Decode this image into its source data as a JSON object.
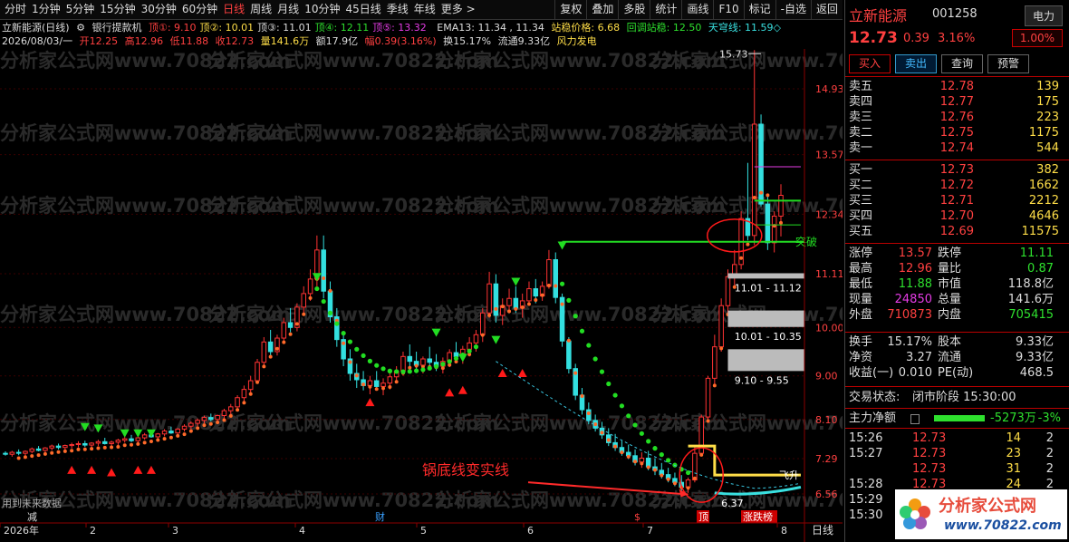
{
  "toolbar": {
    "periods": [
      "分时",
      "1分钟",
      "5分钟",
      "15分钟",
      "30分钟",
      "60分钟",
      "日线",
      "周线",
      "月线",
      "10分钟",
      "45日线",
      "季线",
      "年线",
      "更多 >"
    ],
    "active_period": "日线",
    "actions": [
      "复权",
      "叠加",
      "多股",
      "统计",
      "画线",
      "F10",
      "标记",
      "-自选",
      "返回"
    ]
  },
  "header": {
    "stock_name": "立新能源(日线)",
    "indicator_name": "银行提款机",
    "dings": [
      {
        "label": "顶①:",
        "value": "9.10",
        "color": "#ff4040"
      },
      {
        "label": "顶②:",
        "value": "10.01",
        "color": "#ffde48"
      },
      {
        "label": "顶③:",
        "value": "11.01",
        "color": "#ddd"
      },
      {
        "label": "顶④:",
        "value": "12.11",
        "color": "#2ee02e"
      },
      {
        "label": "顶⑤:",
        "value": "13.32",
        "color": "#e53ce5"
      }
    ],
    "ema": "EMA13: 11.34 , 11.34",
    "zhanwen": "站稳价格: 6.68",
    "huitiao": "回调站稳: 12.50",
    "tianqiong": "天穹线: 11.59◇",
    "line2": {
      "date": "2026/08/03/一",
      "open": "开12.25",
      "high": "高12.96",
      "low": "低11.88",
      "close": "收12.73",
      "vol": "量141.6万",
      "amt": "额17.9亿",
      "amp": "幅0.39(3.16%)",
      "turn": "换15.17%",
      "float": "流通9.33亿",
      "concept": "风力发电"
    }
  },
  "chart_data": {
    "type": "candlestick",
    "y_ticks": [
      "14.93",
      "13.57",
      "12.34",
      "11.11",
      "10.00",
      "9.00",
      "8.10",
      "7.29",
      "6.56"
    ],
    "x_ticks": [
      "2026年",
      "2",
      "3",
      "4",
      "5",
      "6",
      "7",
      "8"
    ],
    "candles": [
      [
        7.4,
        7.44,
        7.35,
        7.38
      ],
      [
        7.38,
        7.45,
        7.33,
        7.42
      ],
      [
        7.42,
        7.48,
        7.36,
        7.4
      ],
      [
        7.4,
        7.46,
        7.34,
        7.44
      ],
      [
        7.44,
        7.52,
        7.4,
        7.49
      ],
      [
        7.49,
        7.55,
        7.44,
        7.46
      ],
      [
        7.46,
        7.53,
        7.42,
        7.51
      ],
      [
        7.51,
        7.58,
        7.46,
        7.55
      ],
      [
        7.55,
        7.6,
        7.48,
        7.52
      ],
      [
        7.52,
        7.58,
        7.45,
        7.56
      ],
      [
        7.56,
        7.62,
        7.5,
        7.58
      ],
      [
        7.58,
        7.65,
        7.52,
        7.6
      ],
      [
        7.6,
        7.66,
        7.53,
        7.57
      ],
      [
        7.57,
        7.63,
        7.5,
        7.61
      ],
      [
        7.61,
        7.68,
        7.55,
        7.64
      ],
      [
        7.64,
        7.72,
        7.58,
        7.6
      ],
      [
        7.6,
        7.66,
        7.52,
        7.63
      ],
      [
        7.63,
        7.7,
        7.57,
        7.67
      ],
      [
        7.67,
        7.75,
        7.62,
        7.7
      ],
      [
        7.7,
        7.78,
        7.63,
        7.66
      ],
      [
        7.66,
        7.74,
        7.6,
        7.72
      ],
      [
        7.72,
        7.82,
        7.68,
        7.78
      ],
      [
        7.78,
        7.86,
        7.72,
        7.74
      ],
      [
        7.74,
        7.82,
        7.68,
        7.8
      ],
      [
        7.8,
        7.9,
        7.75,
        7.86
      ],
      [
        7.86,
        7.95,
        7.8,
        7.82
      ],
      [
        7.82,
        7.92,
        7.77,
        7.9
      ],
      [
        7.9,
        8.0,
        7.85,
        7.96
      ],
      [
        7.96,
        8.06,
        7.9,
        8.02
      ],
      [
        8.02,
        8.12,
        7.96,
        8.08
      ],
      [
        8.08,
        8.18,
        8.02,
        8.14
      ],
      [
        8.14,
        8.22,
        8.06,
        8.1
      ],
      [
        8.1,
        8.2,
        8.04,
        8.18
      ],
      [
        8.18,
        8.32,
        8.12,
        8.28
      ],
      [
        8.28,
        8.42,
        8.2,
        8.36
      ],
      [
        8.36,
        8.6,
        8.3,
        8.55
      ],
      [
        8.55,
        8.8,
        8.48,
        8.72
      ],
      [
        8.72,
        9.0,
        8.65,
        8.9
      ],
      [
        8.9,
        9.35,
        8.84,
        9.28
      ],
      [
        9.28,
        9.8,
        9.2,
        9.7
      ],
      [
        9.7,
        9.95,
        9.4,
        9.5
      ],
      [
        9.5,
        9.85,
        9.42,
        9.78
      ],
      [
        9.78,
        10.2,
        9.7,
        10.1
      ],
      [
        10.1,
        10.4,
        9.9,
        10.0
      ],
      [
        10.0,
        10.5,
        9.92,
        10.42
      ],
      [
        10.42,
        10.85,
        10.3,
        10.7
      ],
      [
        10.7,
        11.2,
        10.55,
        11.0
      ],
      [
        11.0,
        11.9,
        10.85,
        11.6
      ],
      [
        11.6,
        11.9,
        10.6,
        10.75
      ],
      [
        10.75,
        10.95,
        10.1,
        10.22
      ],
      [
        10.22,
        10.4,
        9.6,
        9.75
      ],
      [
        9.75,
        9.9,
        9.2,
        9.35
      ],
      [
        9.35,
        9.55,
        8.9,
        9.05
      ],
      [
        9.05,
        9.25,
        8.75,
        8.92
      ],
      [
        8.92,
        9.1,
        8.7,
        8.8
      ],
      [
        8.8,
        9.0,
        8.62,
        8.9
      ],
      [
        8.9,
        9.1,
        8.7,
        8.78
      ],
      [
        8.78,
        8.95,
        8.6,
        8.85
      ],
      [
        8.85,
        9.05,
        8.72,
        8.98
      ],
      [
        8.98,
        9.2,
        8.85,
        9.1
      ],
      [
        9.1,
        9.5,
        9.0,
        9.4
      ],
      [
        9.4,
        9.65,
        9.2,
        9.3
      ],
      [
        9.3,
        9.5,
        9.1,
        9.22
      ],
      [
        9.22,
        9.4,
        9.05,
        9.35
      ],
      [
        9.35,
        9.6,
        9.2,
        9.28
      ],
      [
        9.28,
        9.45,
        9.1,
        9.2
      ],
      [
        9.2,
        9.38,
        9.05,
        9.3
      ],
      [
        9.3,
        9.55,
        9.18,
        9.48
      ],
      [
        9.48,
        9.7,
        9.3,
        9.4
      ],
      [
        9.4,
        9.62,
        9.25,
        9.55
      ],
      [
        9.55,
        9.8,
        9.4,
        9.68
      ],
      [
        9.68,
        9.95,
        9.5,
        9.85
      ],
      [
        9.85,
        10.4,
        9.7,
        10.3
      ],
      [
        10.3,
        11.15,
        10.2,
        10.9
      ],
      [
        10.9,
        11.1,
        10.1,
        10.25
      ],
      [
        10.25,
        10.6,
        10.05,
        10.45
      ],
      [
        10.45,
        10.8,
        10.3,
        10.6
      ],
      [
        10.6,
        10.85,
        10.3,
        10.4
      ],
      [
        10.4,
        10.7,
        10.2,
        10.55
      ],
      [
        10.55,
        10.95,
        10.45,
        10.8
      ],
      [
        10.8,
        11.0,
        10.5,
        10.65
      ],
      [
        10.65,
        10.95,
        10.55,
        10.85
      ],
      [
        10.85,
        11.6,
        10.8,
        11.4
      ],
      [
        11.4,
        11.55,
        10.5,
        10.62
      ],
      [
        10.62,
        10.7,
        9.6,
        9.72
      ],
      [
        9.72,
        9.8,
        9.05,
        9.15
      ],
      [
        9.15,
        9.25,
        8.5,
        8.6
      ],
      [
        8.6,
        8.75,
        8.2,
        8.3
      ],
      [
        8.3,
        8.45,
        8.0,
        8.08
      ],
      [
        8.08,
        8.2,
        7.85,
        7.92
      ],
      [
        7.92,
        8.05,
        7.7,
        7.78
      ],
      [
        7.78,
        7.92,
        7.55,
        7.62
      ],
      [
        7.62,
        7.8,
        7.45,
        7.52
      ],
      [
        7.52,
        7.66,
        7.35,
        7.42
      ],
      [
        7.42,
        7.58,
        7.28,
        7.35
      ],
      [
        7.35,
        7.48,
        7.15,
        7.22
      ],
      [
        7.22,
        7.42,
        7.1,
        7.3
      ],
      [
        7.3,
        7.45,
        7.05,
        7.12
      ],
      [
        7.12,
        7.3,
        6.95,
        7.05
      ],
      [
        7.05,
        7.2,
        6.88,
        6.96
      ],
      [
        6.96,
        7.1,
        6.8,
        6.88
      ],
      [
        6.88,
        7.0,
        6.72,
        6.8
      ],
      [
        6.8,
        6.95,
        6.62,
        6.7
      ],
      [
        6.7,
        6.9,
        6.58,
        6.85
      ],
      [
        6.85,
        7.55,
        6.8,
        7.4
      ],
      [
        7.4,
        8.2,
        7.35,
        8.15
      ],
      [
        8.15,
        9.0,
        8.1,
        8.95
      ],
      [
        8.95,
        9.85,
        8.8,
        9.6
      ],
      [
        9.6,
        10.6,
        9.5,
        10.45
      ],
      [
        10.45,
        11.2,
        10.3,
        11.05
      ],
      [
        11.05,
        11.6,
        10.8,
        11.3
      ],
      [
        11.3,
        12.4,
        11.2,
        12.25
      ],
      [
        12.25,
        13.4,
        11.8,
        11.9
      ],
      [
        11.9,
        15.73,
        11.7,
        14.2
      ],
      [
        14.2,
        14.4,
        12.5,
        12.55
      ],
      [
        12.55,
        12.7,
        11.6,
        11.75
      ],
      [
        11.75,
        12.4,
        11.55,
        12.3
      ],
      [
        12.3,
        12.96,
        11.88,
        12.73
      ]
    ]
  },
  "chart_text": {
    "watermark": "分析家公式网www.70822.com",
    "future_label": "用到未来数据",
    "annotation": "锅底线变实线",
    "max_label": "15.73",
    "breakthrough": "突破",
    "fly": "飞升",
    "low_label": "6.37",
    "box1": "11.01 - 11.12",
    "box2": "10.01 - 10.35",
    "box3": "9.10 - 9.55",
    "bottom_tags": [
      "减",
      "财",
      "$",
      "顶",
      "涨跌榜"
    ],
    "period_label": "日线"
  },
  "quote": {
    "name": "立新能源",
    "code": "001258",
    "sector": "电力",
    "price": "12.73",
    "change": "0.39",
    "change_pct": "3.16%",
    "boxed_pct": "1.00%",
    "buttons": [
      "买入",
      "卖出",
      "查询",
      "预警"
    ],
    "sells": [
      {
        "label": "卖五",
        "price": "12.78",
        "vol": "139"
      },
      {
        "label": "卖四",
        "price": "12.77",
        "vol": "175"
      },
      {
        "label": "卖三",
        "price": "12.76",
        "vol": "223"
      },
      {
        "label": "卖二",
        "price": "12.75",
        "vol": "1175"
      },
      {
        "label": "卖一",
        "price": "12.74",
        "vol": "544"
      }
    ],
    "buys": [
      {
        "label": "买一",
        "price": "12.73",
        "vol": "382"
      },
      {
        "label": "买二",
        "price": "12.72",
        "vol": "1662"
      },
      {
        "label": "买三",
        "price": "12.71",
        "vol": "2212"
      },
      {
        "label": "买四",
        "price": "12.70",
        "vol": "4646"
      },
      {
        "label": "买五",
        "price": "12.69",
        "vol": "11575"
      }
    ],
    "stats": [
      {
        "l1": "涨停",
        "v1": "13.57",
        "c1": "#ff4040",
        "l2": "跌停",
        "v2": "11.11",
        "c2": "#2ee02e"
      },
      {
        "l1": "最高",
        "v1": "12.96",
        "c1": "#ff4040",
        "l2": "量比",
        "v2": "0.87",
        "c2": "#2ee02e"
      },
      {
        "l1": "最低",
        "v1": "11.88",
        "c1": "#2ee02e",
        "l2": "市值",
        "v2": "118.8亿",
        "c2": "#ddd"
      },
      {
        "l1": "现量",
        "v1": "24850",
        "c1": "#e53ce5",
        "l2": "总量",
        "v2": "141.6万",
        "c2": "#ddd"
      },
      {
        "l1": "外盘",
        "v1": "710873",
        "c1": "#ff4040",
        "l2": "内盘",
        "v2": "705415",
        "c2": "#2ee02e"
      }
    ],
    "stats2": [
      {
        "l1": "换手",
        "v1": "15.17%",
        "c1": "#ddd",
        "l2": "股本",
        "v2": "9.33亿",
        "c2": "#ddd"
      },
      {
        "l1": "净资",
        "v1": "3.27",
        "c1": "#ddd",
        "l2": "流通",
        "v2": "9.33亿",
        "c2": "#ddd"
      },
      {
        "l1": "收益(一)",
        "v1": "0.010",
        "c1": "#ddd",
        "l2": "PE(动)",
        "v2": "468.5",
        "c2": "#ddd"
      }
    ],
    "trade_status_label": "交易状态:",
    "trade_status": "闭市阶段 15:30:00",
    "main_net_label": "主力净额",
    "main_net_value": "-5273万",
    "main_net_pct": "-3%",
    "ticks": [
      {
        "t": "15:26",
        "p": "12.73",
        "v": "14",
        "n": "2"
      },
      {
        "t": "15:27",
        "p": "12.73",
        "v": "23",
        "n": "2"
      },
      {
        "t": "",
        "p": "12.73",
        "v": "31",
        "n": "2"
      },
      {
        "t": "15:28",
        "p": "12.73",
        "v": "24",
        "n": "2"
      },
      {
        "t": "15:29",
        "p": "12.73",
        "v": "",
        "n": ""
      },
      {
        "t": "15:30",
        "p": "",
        "v": "",
        "n": ""
      }
    ],
    "logo_text": "分析家公式网",
    "logo_url": "www.70822.com"
  }
}
